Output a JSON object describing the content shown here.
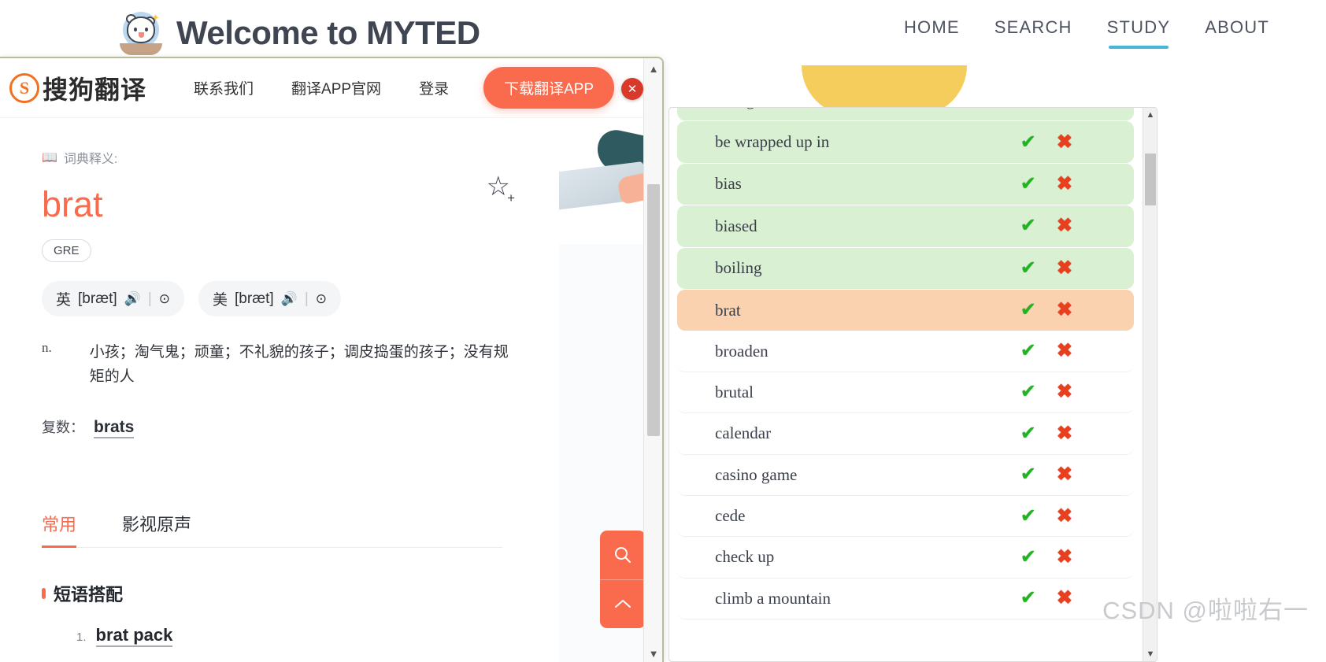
{
  "myted": {
    "title": "Welcome to MYTED",
    "logo_icon": "bear-mascot-icon",
    "nav": [
      {
        "label": "HOME",
        "active": false
      },
      {
        "label": "SEARCH",
        "active": false
      },
      {
        "label": "STUDY",
        "active": true
      },
      {
        "label": "ABOUT",
        "active": false
      }
    ],
    "accent_color": "#45b7d8",
    "title_color": "#3f4652"
  },
  "sogou": {
    "logo_mark": "S",
    "logo_text": "搜狗翻译",
    "links": [
      {
        "label": "联系我们"
      },
      {
        "label": "翻译APP官网"
      },
      {
        "label": "登录"
      }
    ],
    "download_button": "下载翻译APP",
    "close_icon": "close-icon",
    "button_color": "#fa6a4d",
    "dictionary": {
      "section_label": "词典释义:",
      "book_icon": "book-icon",
      "headword": "brat",
      "headword_color": "#fa6a4d",
      "favorite_icon": "star-plus-icon",
      "tag": "GRE",
      "phonetics": [
        {
          "region": "英",
          "ipa": "[bræt]",
          "speaker_icon": "speaker-icon",
          "repeat_icon": "play-circle-icon"
        },
        {
          "region": "美",
          "ipa": "[bræt]",
          "speaker_icon": "speaker-icon",
          "repeat_icon": "play-circle-icon"
        }
      ],
      "definitions": [
        {
          "pos": "n.",
          "text": "小孩；淘气鬼；顽童；不礼貌的孩子；调皮捣蛋的孩子；没有规矩的人"
        }
      ],
      "plural_label": "复数：",
      "plural_value": "brats",
      "tabs": [
        {
          "label": "常用",
          "active": true
        },
        {
          "label": "影视原声",
          "active": false
        }
      ],
      "phrase_section_title": "短语搭配",
      "phrases": [
        {
          "num": "1.",
          "text": "brat pack"
        }
      ]
    },
    "scrollbar": {
      "up_icon": "chevron-up-icon",
      "down_icon": "chevron-down-icon"
    }
  },
  "fab": {
    "search_icon": "search-icon",
    "scroll_top_icon": "chevron-up-icon",
    "color": "#fa6a4d"
  },
  "wordlist": {
    "tick_icon": "check-icon",
    "cross_icon": "cross-icon",
    "tick_color": "#21b421",
    "cross_color": "#e8401f",
    "known_color": "#d9f0d2",
    "current_color": "#fad2b0",
    "scrollbar": {
      "up_icon": "chevron-up-icon",
      "down_icon": "chevron-down-icon"
    },
    "rows": [
      {
        "word": "background",
        "state": "known"
      },
      {
        "word": "be wrapped up in",
        "state": "known"
      },
      {
        "word": "bias",
        "state": "known"
      },
      {
        "word": "biased",
        "state": "known"
      },
      {
        "word": "boiling",
        "state": "known"
      },
      {
        "word": "brat",
        "state": "current"
      },
      {
        "word": "broaden",
        "state": "default"
      },
      {
        "word": "brutal",
        "state": "default"
      },
      {
        "word": "calendar",
        "state": "default"
      },
      {
        "word": "casino game",
        "state": "default"
      },
      {
        "word": "cede",
        "state": "default"
      },
      {
        "word": "check up",
        "state": "default"
      },
      {
        "word": "climb a mountain",
        "state": "default"
      }
    ]
  },
  "watermark": {
    "text": "CSDN @啦啦右一"
  }
}
